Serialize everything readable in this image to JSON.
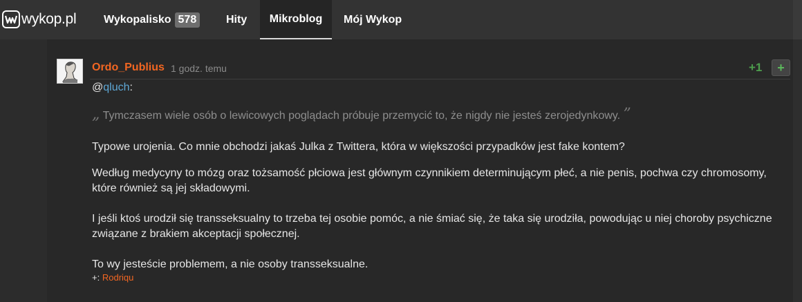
{
  "header": {
    "logo_text": "wykop.pl",
    "nav": [
      {
        "label": "Wykopalisko",
        "badge": "578"
      },
      {
        "label": "Hity"
      },
      {
        "label": "Mikroblog",
        "active": true
      },
      {
        "label": "Mój Wykop"
      }
    ]
  },
  "post": {
    "author": "Ordo_Publius",
    "time": "1 godz. temu",
    "score": "+1",
    "plus_button": "+",
    "mention_prefix": "@",
    "mention_user": "qluch",
    "mention_suffix": ":",
    "quote_open": "„",
    "quote": "Tymczasem wiele osób o lewicowych poglądach próbuje przemycić to, że nigdy nie jesteś zerojedynkowy.",
    "quote_close": "”",
    "paragraphs": [
      "Typowe urojenia. Co mnie obchodzi jakaś Julka z Twittera, która w większości przypadków jest fake kontem?",
      "Według medycyny to mózg oraz tożsamość płciowa jest głównym czynnikiem determinującym płeć, a nie penis, pochwa czy chromosomy, które również są jej składowymi.",
      "I jeśli ktoś urodził się transseksualny to trzeba tej osobie pomóc, a nie śmiać się, że taka się urodziła, powodując u niej choroby psychiczne związane z brakiem akceptacji społecznej.",
      "To wy jesteście problemem, a nie osoby transseksualne."
    ],
    "voters_label": "+:",
    "voters": "Rodriqu"
  },
  "colors": {
    "accent": "#f26622",
    "link": "#5ea8d6",
    "plus": "#4d9e4d",
    "background": "#282828"
  }
}
